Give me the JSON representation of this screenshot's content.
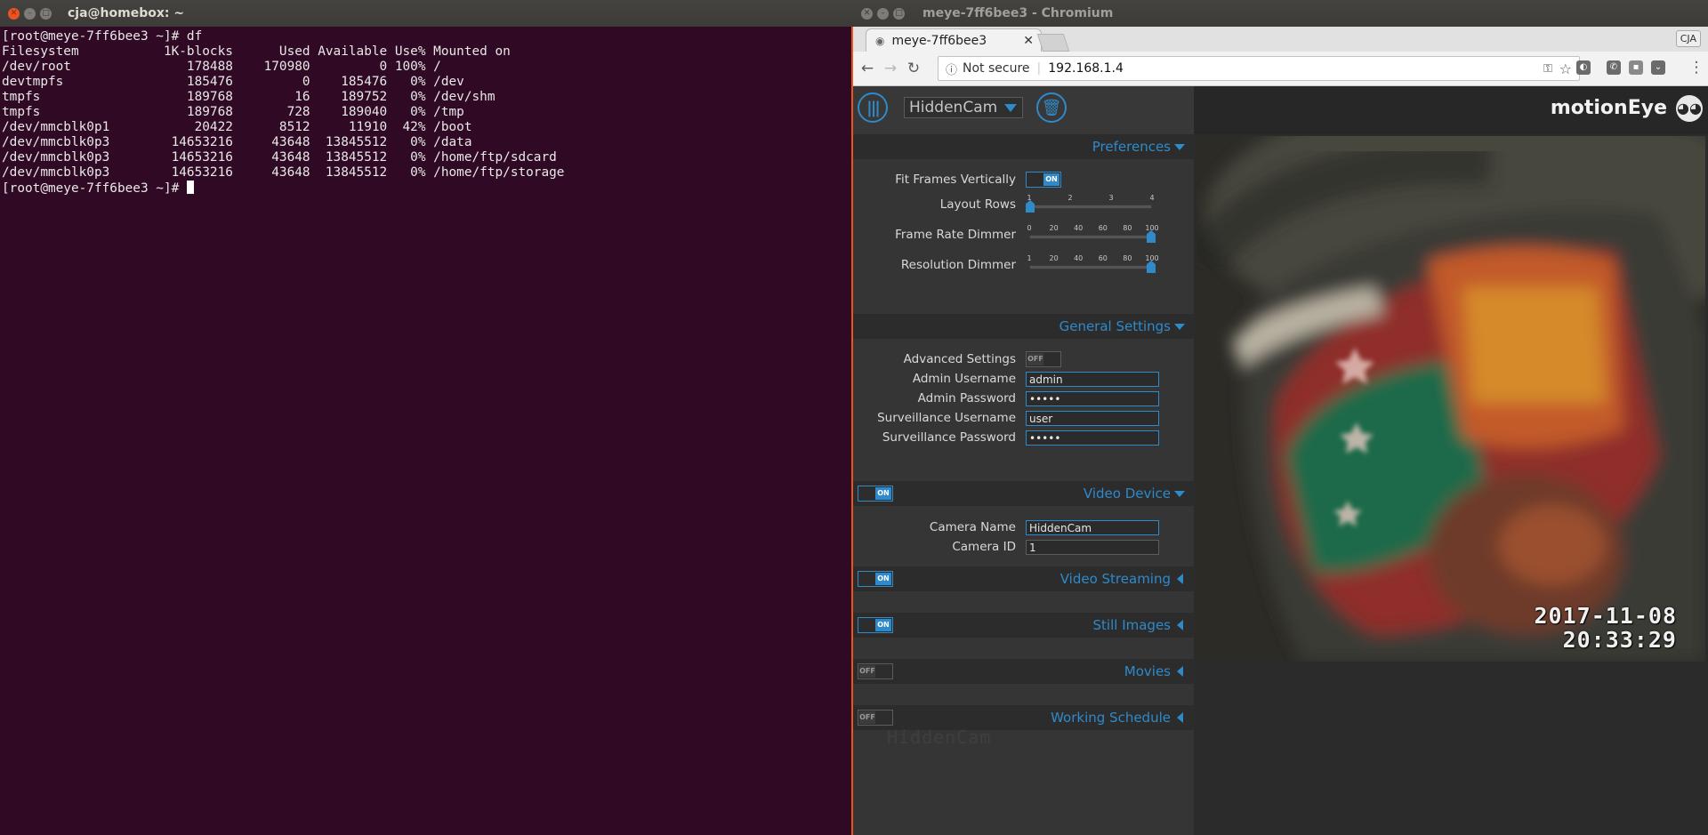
{
  "terminal": {
    "title": "cja@homebox: ~",
    "lines": [
      "[root@meye-7ff6bee3 ~]# df",
      "Filesystem           1K-blocks      Used Available Use% Mounted on",
      "/dev/root               178488    170980         0 100% /",
      "devtmpfs                185476         0    185476   0% /dev",
      "tmpfs                   189768        16    189752   0% /dev/shm",
      "tmpfs                   189768       728    189040   0% /tmp",
      "/dev/mmcblk0p1           20422      8512     11910  42% /boot",
      "/dev/mmcblk0p3        14653216     43648  13845512   0% /data",
      "/dev/mmcblk0p3        14653216     43648  13845512   0% /home/ftp/sdcard",
      "/dev/mmcblk0p3        14653216     43648  13845512   0% /home/ftp/storage"
    ],
    "prompt": "[root@meye-7ff6bee3 ~]# "
  },
  "browser": {
    "window_title": "meye-7ff6bee3 - Chromium",
    "tab_title": "meye-7ff6bee3",
    "profile": "CJA",
    "security_label": "Not secure",
    "url": "192.168.1.4"
  },
  "motioneye": {
    "camera_select": "HiddenCam",
    "brand": "motionEye",
    "preferences": {
      "title": "Preferences",
      "fit_frames_label": "Fit Frames Vertically",
      "fit_frames": "ON",
      "layout_rows_label": "Layout Rows",
      "layout_rows_ticks": [
        "1",
        "2",
        "3",
        "4"
      ],
      "layout_rows_value": 1,
      "frame_rate_label": "Frame Rate Dimmer",
      "frame_rate_ticks": [
        "0",
        "20",
        "40",
        "60",
        "80",
        "100"
      ],
      "frame_rate_value": 100,
      "resolution_label": "Resolution Dimmer",
      "resolution_ticks": [
        "1",
        "20",
        "40",
        "60",
        "80",
        "100"
      ],
      "resolution_value": 100
    },
    "general": {
      "title": "General Settings",
      "advanced_label": "Advanced Settings",
      "advanced": "OFF",
      "admin_user_label": "Admin Username",
      "admin_user": "admin",
      "admin_pass_label": "Admin Password",
      "admin_pass": "•••••",
      "surv_user_label": "Surveillance Username",
      "surv_user": "user",
      "surv_pass_label": "Surveillance Password",
      "surv_pass": "•••••"
    },
    "video_device": {
      "title": "Video Device",
      "toggle": "ON",
      "camera_name_label": "Camera Name",
      "camera_name": "HiddenCam",
      "camera_id_label": "Camera ID",
      "camera_id": "1"
    },
    "video_streaming": {
      "title": "Video Streaming",
      "toggle": "ON"
    },
    "still_images": {
      "title": "Still Images",
      "toggle": "ON"
    },
    "movies": {
      "title": "Movies",
      "toggle": "OFF"
    },
    "working_schedule": {
      "title": "Working Schedule",
      "toggle": "OFF"
    },
    "ghost_text": "HiddenCam",
    "camera_frame": {
      "date": "2017-11-08",
      "time": "20:33:29"
    }
  },
  "colors": {
    "terminal_bg": "#300a24",
    "accent": "#2f8ac9",
    "ubuntu_orange": "#e95420"
  }
}
